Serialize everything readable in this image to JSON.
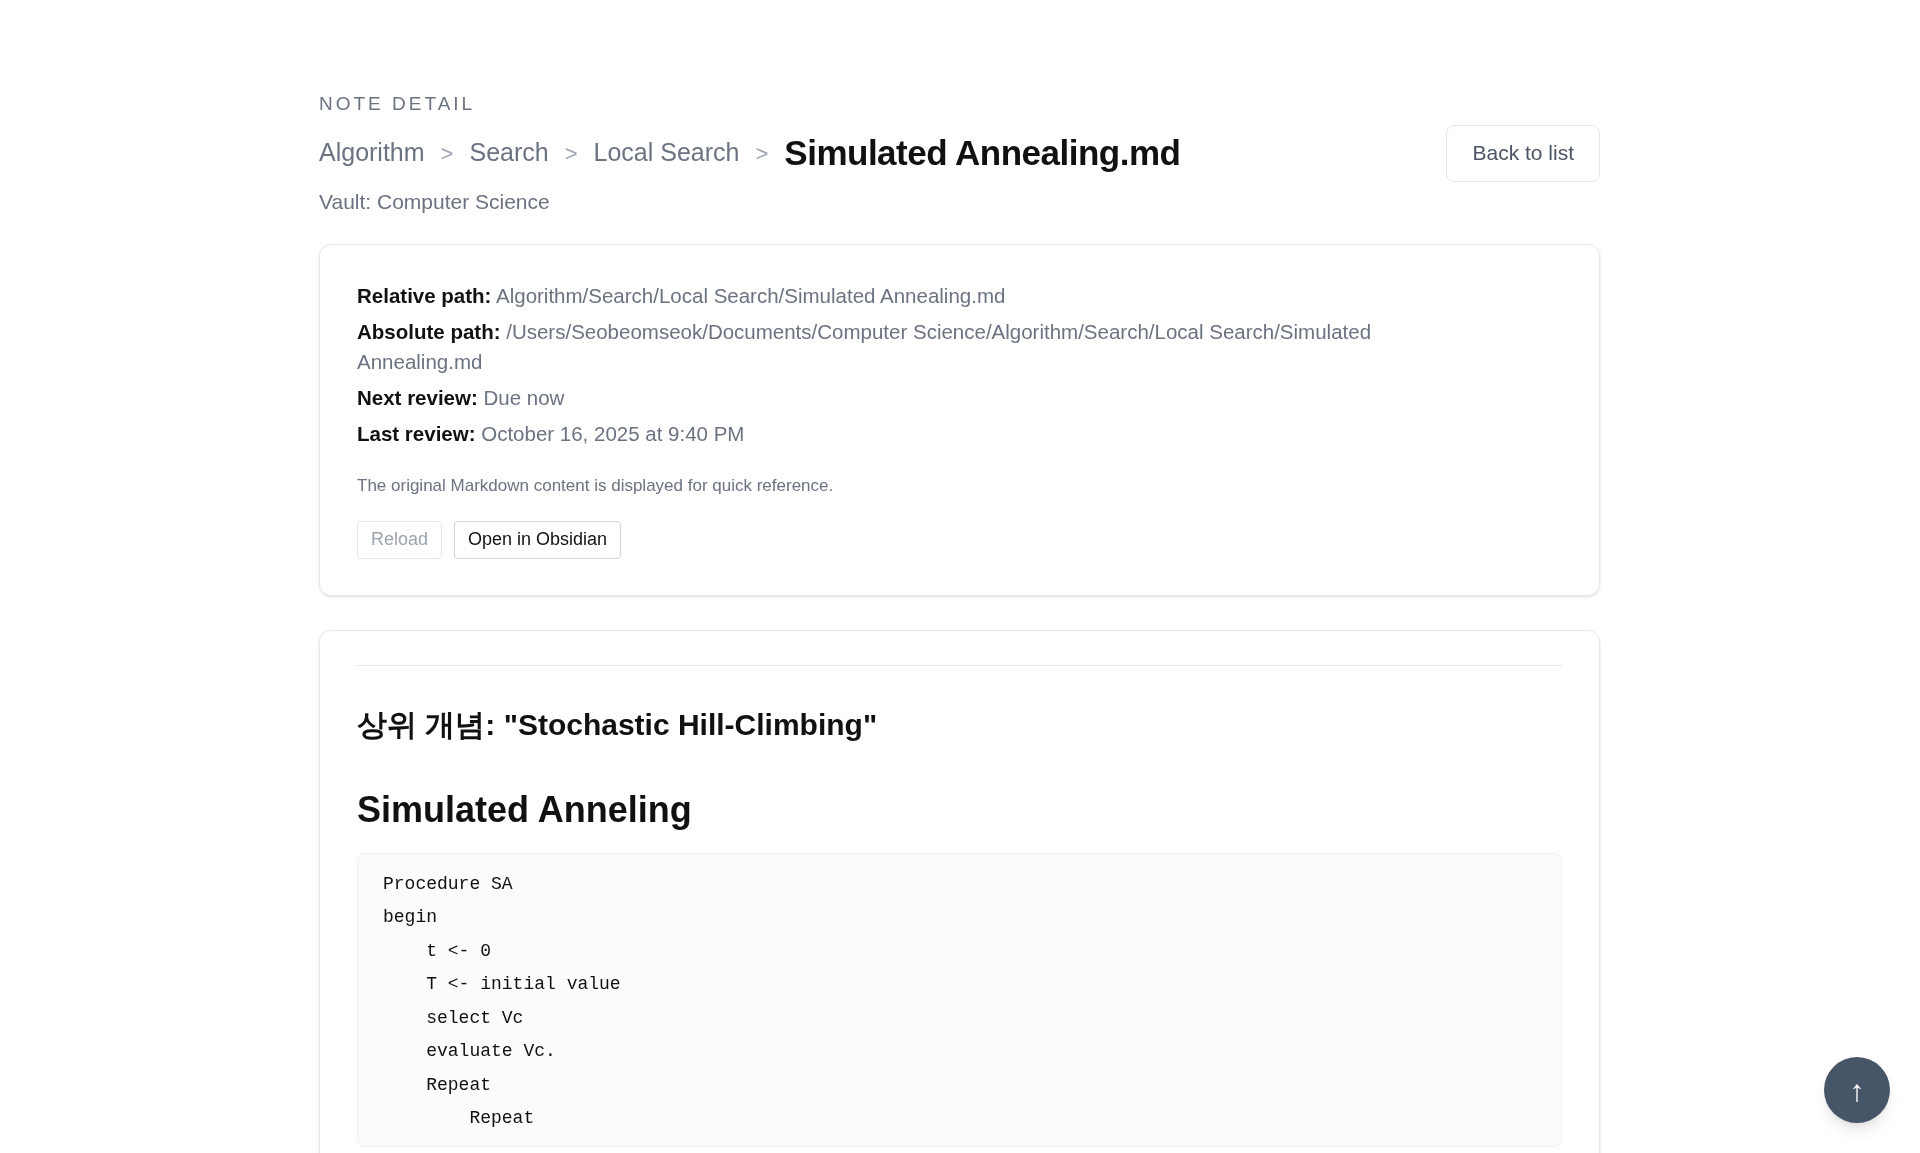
{
  "eyebrow": "NOTE DETAIL",
  "breadcrumb": [
    {
      "label": "Algorithm"
    },
    {
      "label": "Search"
    },
    {
      "label": "Local Search"
    }
  ],
  "breadcrumb_separator": ">",
  "title": "Simulated Annealing.md",
  "back_button": "Back to list",
  "vault": "Vault: Computer Science",
  "info": [
    {
      "label": "Relative path:",
      "value": "Algorithm/Search/Local Search/Simulated Annealing.md"
    },
    {
      "label": "Absolute path:",
      "value": "/Users/Seobeomseok/Documents/Computer Science/Algorithm/Search/Local Search/Simulated Annealing.md"
    },
    {
      "label": "Next review:",
      "value": "Due now"
    },
    {
      "label": "Last review:",
      "value": "October 16, 2025 at 9:40 PM"
    }
  ],
  "note": "The original Markdown content is displayed for quick reference.",
  "actions": [
    {
      "label": "Reload",
      "disabled": true
    },
    {
      "label": "Open in Obsidian",
      "disabled": false
    }
  ],
  "content": [
    {
      "kind": "rule"
    },
    {
      "kind": "h3",
      "text": "상위 개념: \"Stochastic Hill-Climbing\""
    },
    {
      "kind": "h2",
      "text": "Simulated Anneling"
    },
    {
      "kind": "code",
      "lines": [
        "Procedure SA",
        "begin",
        "    t <- 0",
        "    T <- initial value",
        "    select Vc",
        "    evaluate Vc.",
        "    Repeat",
        "        Repeat"
      ]
    }
  ],
  "scroll_top_button": "↑"
}
